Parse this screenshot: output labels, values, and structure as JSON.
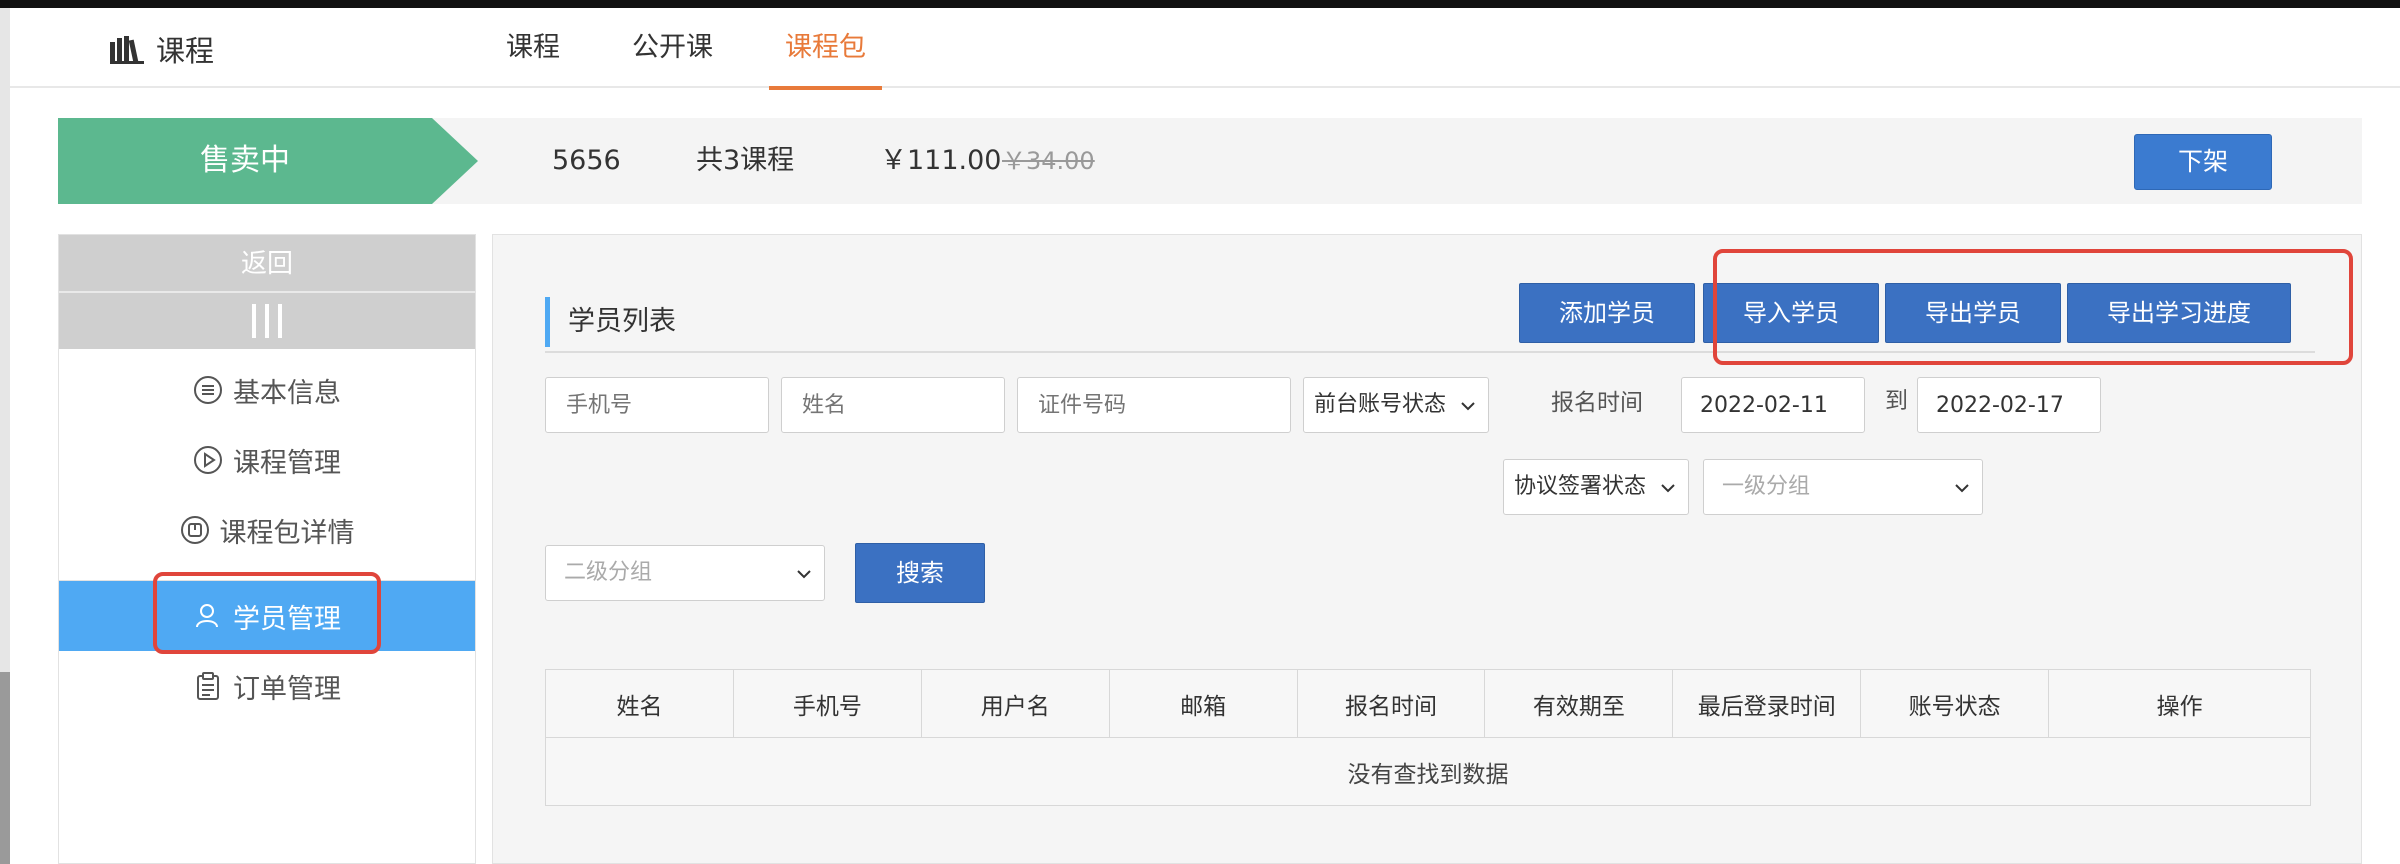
{
  "header": {
    "brand_icon": "books-icon",
    "brand_label": "课程",
    "tabs": [
      {
        "label": "课程",
        "active": false
      },
      {
        "label": "公开课",
        "active": false
      },
      {
        "label": "课程包",
        "active": true
      }
    ]
  },
  "banner": {
    "status": "售卖中",
    "name": "5656",
    "course_count": "共3课程",
    "price": "￥111.00",
    "original_price": "￥34.00",
    "offshelf_button": "下架"
  },
  "sidebar": {
    "back": "返回",
    "items": [
      {
        "label": "基本信息",
        "icon": "list-icon",
        "active": false
      },
      {
        "label": "课程管理",
        "icon": "play-circle-icon",
        "active": false
      },
      {
        "label": "课程包详情",
        "icon": "book-box-icon",
        "active": false
      },
      {
        "label": "学员管理",
        "icon": "user-icon",
        "active": true
      },
      {
        "label": "订单管理",
        "icon": "clipboard-icon",
        "active": false
      }
    ]
  },
  "main": {
    "section_title": "学员列表",
    "actions": {
      "add": "添加学员",
      "import": "导入学员",
      "export": "导出学员",
      "export_progress": "导出学习进度"
    },
    "filters": {
      "phone_placeholder": "手机号",
      "name_placeholder": "姓名",
      "id_placeholder": "证件号码",
      "account_status": "前台账号状态",
      "signup_label": "报名时间",
      "date_from": "2022-02-11",
      "to_label": "到",
      "date_to": "2022-02-17",
      "agreement_status": "协议签署状态",
      "group_level1": "一级分组",
      "group_level2": "二级分组",
      "search_button": "搜索"
    },
    "table": {
      "columns": [
        "姓名",
        "手机号",
        "用户名",
        "邮箱",
        "报名时间",
        "有效期至",
        "最后登录时间",
        "账号状态",
        "操作"
      ],
      "empty_text": "没有查找到数据"
    }
  },
  "colors": {
    "accent_orange": "#e87a3a",
    "status_green": "#5cb88f",
    "primary_blue": "#3b71c2",
    "active_sidebar": "#4fa9f3",
    "highlight_red": "#e0453b"
  }
}
